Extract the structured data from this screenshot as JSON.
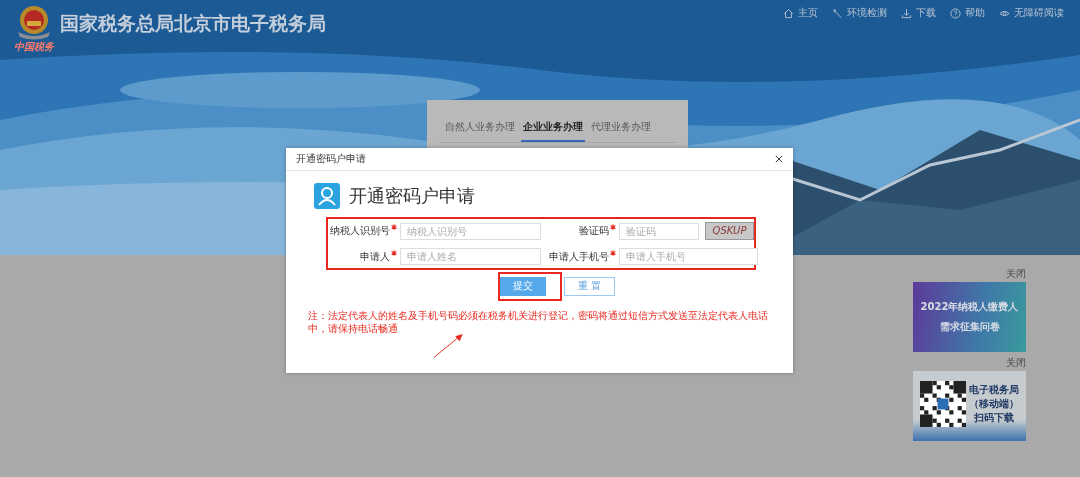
{
  "header": {
    "logo_caption": "中国税务",
    "title": "国家税务总局北京市电子税务局",
    "nav": [
      {
        "label": "主页",
        "kind": "home"
      },
      {
        "label": "环境检测",
        "kind": "wrench"
      },
      {
        "label": "下载",
        "kind": "download"
      },
      {
        "label": "帮助",
        "kind": "help"
      },
      {
        "label": "无障碍阅读",
        "kind": "eye"
      }
    ]
  },
  "login_tabs": [
    {
      "label": "自然人业务办理",
      "selected": false
    },
    {
      "label": "企业业务办理",
      "selected": true
    },
    {
      "label": "代理业务办理",
      "selected": false
    }
  ],
  "dialog": {
    "title": "开通密码户申请",
    "heading": "开通密码户申请",
    "fields": [
      {
        "label": "纳税人识别号",
        "required": true,
        "placeholder": "纳税人识别号",
        "kind": "text"
      },
      {
        "label": "验证码",
        "required": true,
        "placeholder": "验证码",
        "kind": "captcha",
        "captcha": "QSKUP"
      },
      {
        "label": "申请人",
        "required": true,
        "placeholder": "申请人姓名",
        "kind": "text"
      },
      {
        "label": "申请人手机号",
        "required": true,
        "placeholder": "申请人手机号",
        "kind": "text"
      }
    ],
    "buttons": [
      {
        "label": "提交",
        "kind": "primary"
      },
      {
        "label": "重 置",
        "kind": "secondary"
      }
    ],
    "note": "注：法定代表人的姓名及手机号码必须在税务机关进行登记，密码将通过短信方式发送至法定代表人电话中，请保持电话畅通"
  },
  "ads": [
    {
      "close": "关闭",
      "kind": "survey",
      "lines": [
        "2022年纳税人缴费人",
        "需求征集问卷"
      ]
    },
    {
      "close": "关闭",
      "kind": "qr",
      "lines": [
        "电子税务局",
        "（移动端）",
        "扫码下载"
      ]
    }
  ]
}
